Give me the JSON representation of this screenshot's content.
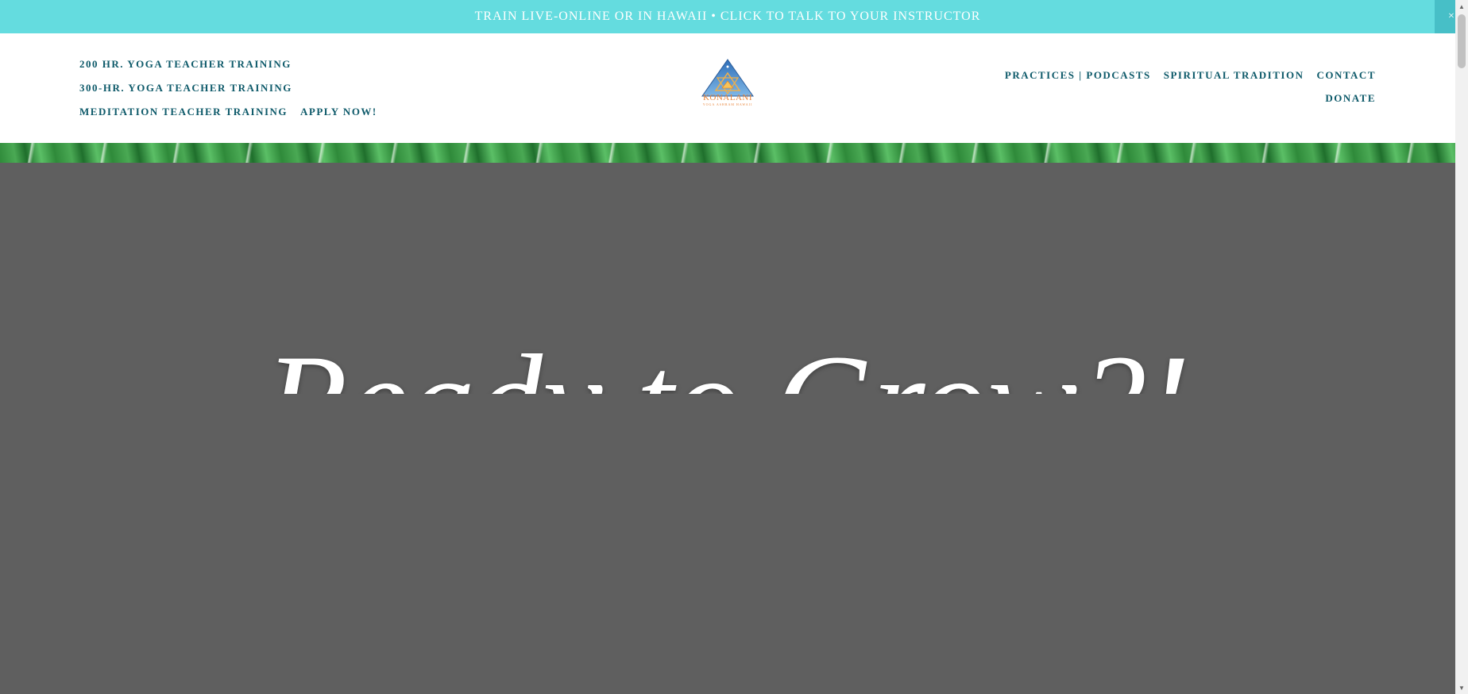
{
  "announcement": {
    "text": "TRAIN LIVE-ONLINE OR IN HAWAII • CLICK TO TALK TO YOUR INSTRUCTOR",
    "close_label": "×"
  },
  "nav_left": {
    "item1": "200 HR. YOGA TEACHER TRAINING",
    "item2": "300-HR. YOGA TEACHER TRAINING",
    "item3": "MEDITATION TEACHER TRAINING",
    "item4": "APPLY NOW!"
  },
  "logo": {
    "name": "KONALANI",
    "sub": "YOGA ASHRAM HAWAII"
  },
  "nav_right": {
    "item1": "PRACTICES | PODCASTS",
    "item2": "SPIRITUAL TRADITION",
    "item3": "CONTACT",
    "item4": "DONATE"
  },
  "hero": {
    "title": "Ready to Grow?!"
  },
  "colors": {
    "announce_bg": "#64dcdf",
    "nav_text": "#0e5a6a",
    "hero_bg": "#5f5f5f",
    "logo_accent": "#e8843a"
  },
  "icons": {
    "close": "close-icon",
    "scroll_up": "chevron-up-icon",
    "scroll_down": "chevron-down-icon"
  }
}
